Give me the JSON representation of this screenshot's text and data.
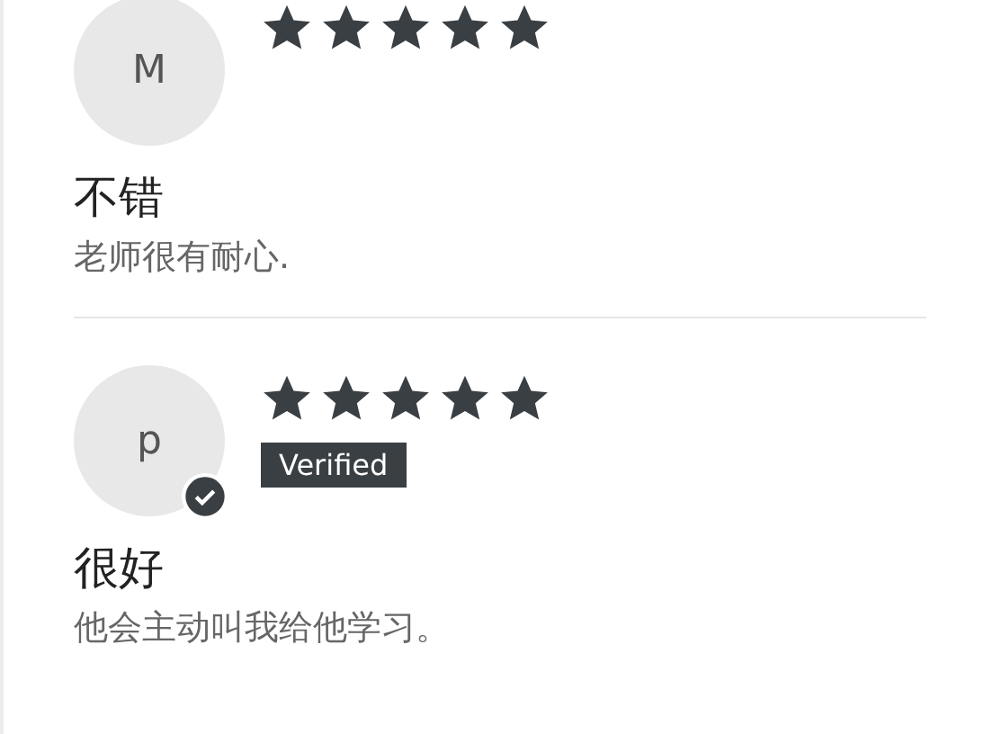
{
  "reviews": [
    {
      "initial": "M",
      "stars": 5,
      "verified": false,
      "title": "不错",
      "body": "老师很有耐心."
    },
    {
      "initial": "p",
      "stars": 5,
      "verified": true,
      "badge": "Verified",
      "title": "很好",
      "body": "他会主动叫我给他学习。"
    }
  ]
}
